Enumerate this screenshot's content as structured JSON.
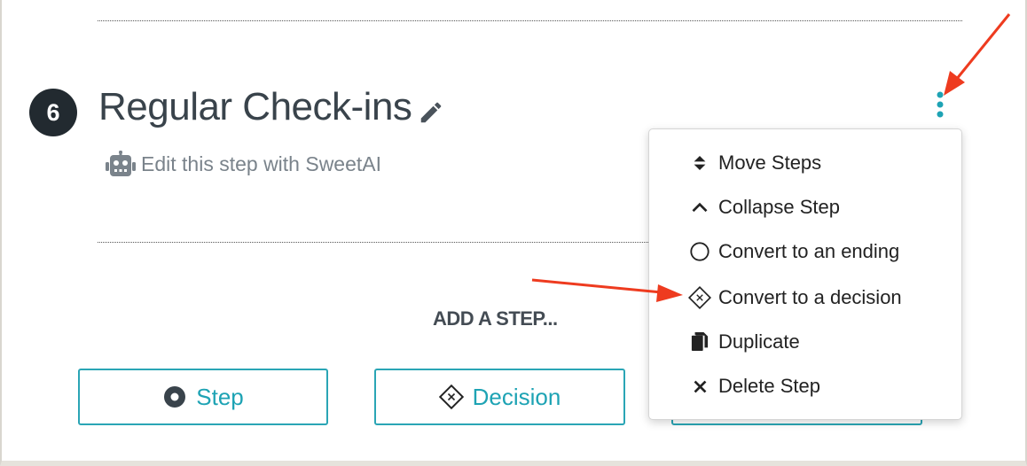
{
  "step": {
    "number": "6",
    "title": "Regular Check-ins",
    "sweetai_label": "Edit this step with SweetAI"
  },
  "add_step": {
    "label": "ADD A STEP...",
    "buttons": [
      {
        "label": "Step",
        "icon": "record-circle-icon"
      },
      {
        "label": "Decision",
        "icon": "decision-diamond-icon"
      }
    ]
  },
  "menu": {
    "items": [
      {
        "label": "Move Steps",
        "icon": "sort-arrows-icon"
      },
      {
        "label": "Collapse Step",
        "icon": "chevron-up-icon"
      },
      {
        "label": "Convert to an ending",
        "icon": "circle-outline-icon"
      },
      {
        "label": "Convert to a decision",
        "icon": "decision-diamond-icon"
      },
      {
        "label": "Duplicate",
        "icon": "copy-icon"
      },
      {
        "label": "Delete Step",
        "icon": "close-icon"
      }
    ]
  },
  "colors": {
    "accent": "#1ea3b4",
    "title": "#39434b",
    "annotation_arrow": "#ee3b1f"
  }
}
